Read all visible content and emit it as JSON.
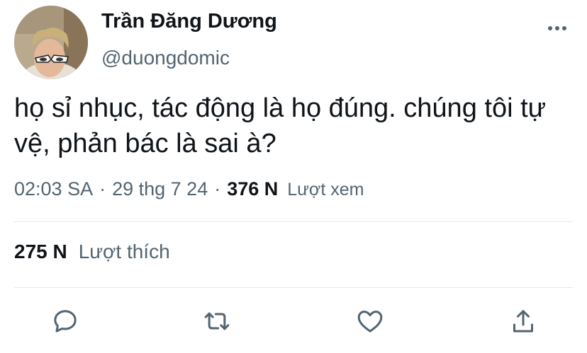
{
  "author": {
    "display_name": "Trần Đăng Dương",
    "handle": "@duongdomic"
  },
  "tweet": {
    "text": "họ sỉ nhục, tác động là họ đúng. chúng tôi tự vệ, phản bác là sai à?"
  },
  "meta": {
    "time": "02:03 SA",
    "separator": "·",
    "date": "29 thg 7 24",
    "views_count": "376 N",
    "views_label": "Lượt xem"
  },
  "stats": {
    "likes_count": "275 N",
    "likes_label": "Lượt thích"
  },
  "icons": {
    "more": "more-horizontal-icon",
    "reply": "reply-icon",
    "retweet": "retweet-icon",
    "like": "heart-icon",
    "share": "share-icon"
  },
  "colors": {
    "text_primary": "#0f1419",
    "text_secondary": "#536471",
    "divider": "#e1e8ed",
    "icon": "#536471"
  }
}
